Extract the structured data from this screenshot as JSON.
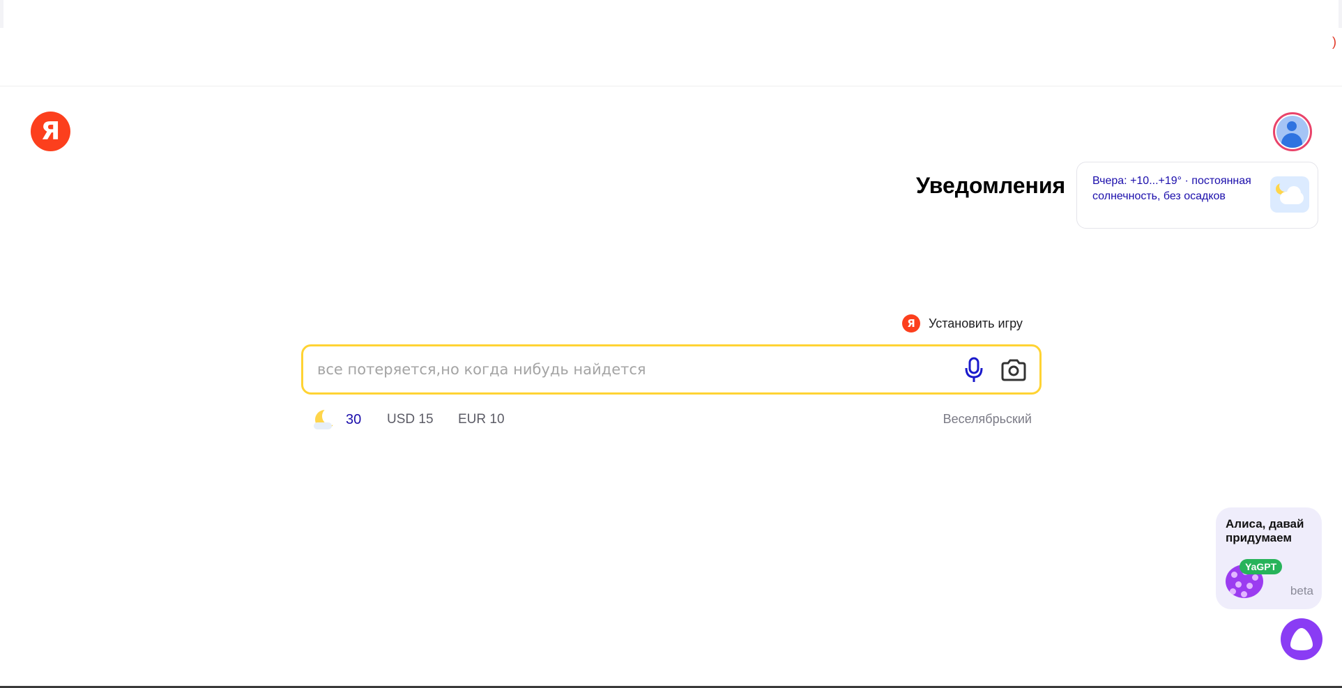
{
  "header": {
    "logo_text": "Я",
    "edge_mark": ")"
  },
  "notifications": {
    "title": "Уведомления",
    "weather_summary": "Вчера: +10...+19° · постоянная солнечность, без осадков"
  },
  "promo": {
    "icon_text": "Я",
    "label": "Установить игру"
  },
  "search": {
    "placeholder": "все потеряется,но когда нибудь найдется",
    "value": "",
    "mic_icon": "microphone-icon",
    "camera_icon": "camera-icon"
  },
  "info": {
    "temperature": "30",
    "usd": "USD 15",
    "eur": "EUR 10",
    "city": "Веселябрьский"
  },
  "alisa": {
    "prompt": "Алиса, давай придумаем",
    "badge": "YaGPT",
    "beta": "beta"
  },
  "colors": {
    "brand": "#fc3f1d",
    "search_border": "#ffd333",
    "link": "#1a0dab",
    "alisa": "#8a3cf4"
  }
}
